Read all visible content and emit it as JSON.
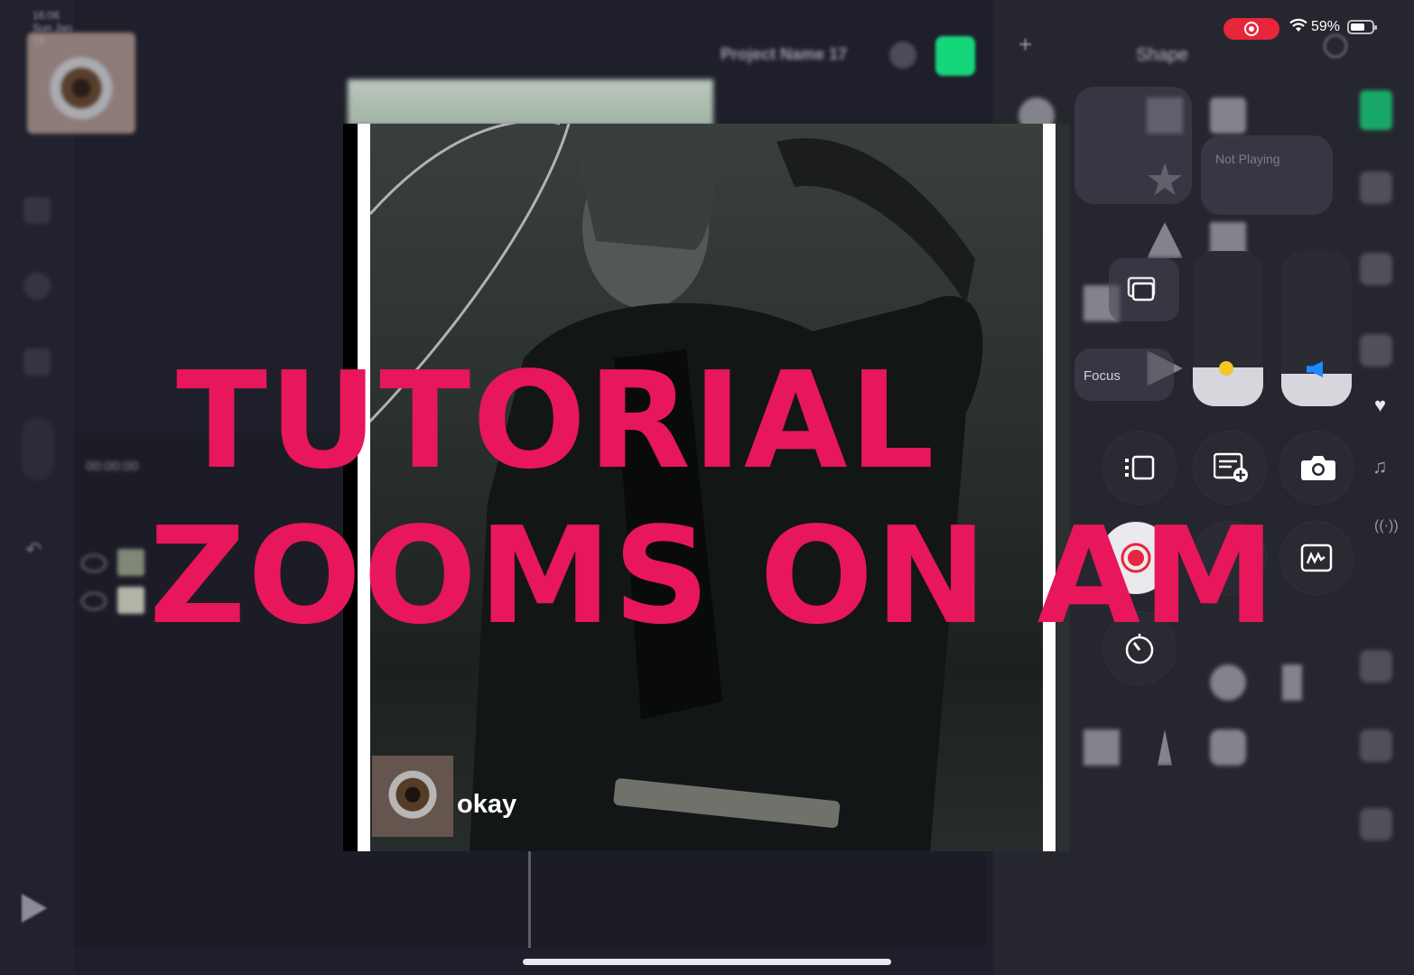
{
  "status_bar": {
    "time_blurred": "16:06  Sun Jan 19",
    "battery_percent": "59%"
  },
  "app": {
    "project_name": "Project Name 17",
    "timecode": "00:00:00",
    "panel_title": "Shape",
    "accent_color": "#15d67a"
  },
  "control_center": {
    "now_playing": "Not Playing",
    "focus_label": "Focus",
    "brightness_level": 0.25,
    "volume_level": 0.2
  },
  "video": {
    "title_line1": "TUTORIAL",
    "title_line2": "ZOOMS ON AM",
    "title_color": "#e8165a",
    "caption": "okay"
  }
}
